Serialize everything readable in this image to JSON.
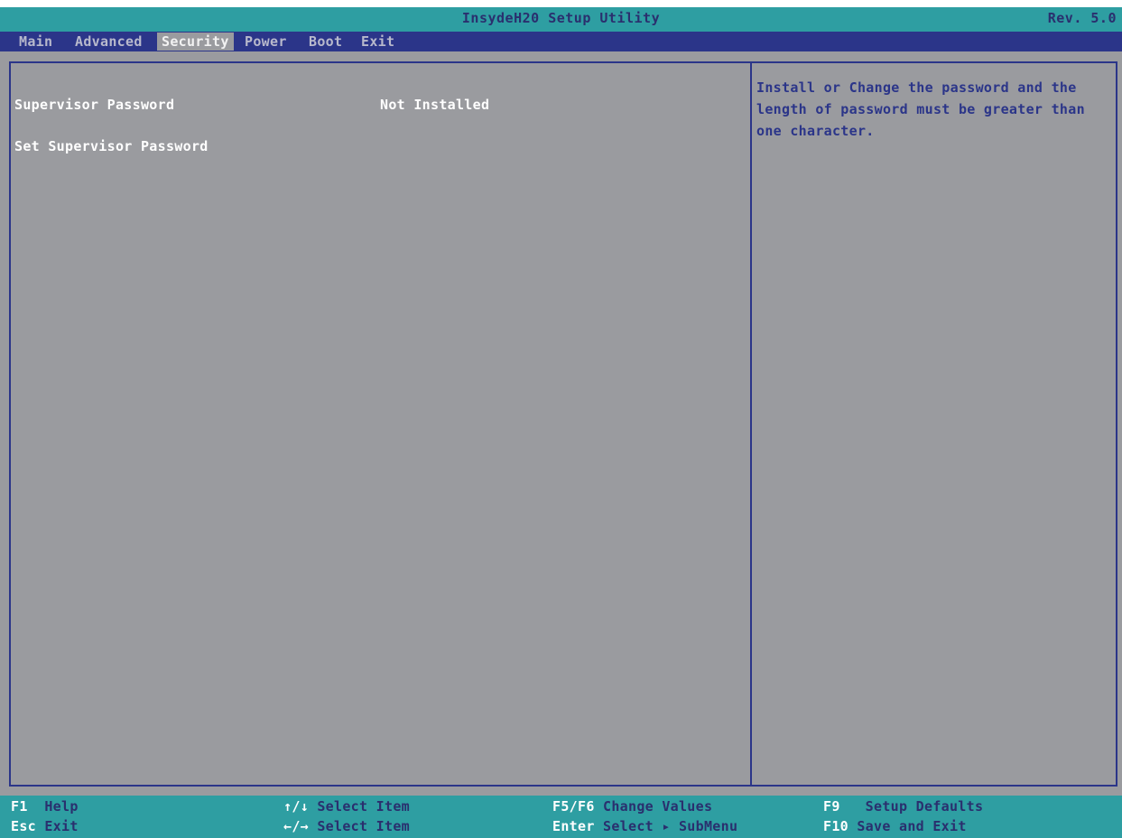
{
  "window": {
    "title": "InsydeH20 Setup Utility",
    "revision": "Rev. 5.0"
  },
  "menu": {
    "tabs": [
      {
        "label": "Main",
        "active": false
      },
      {
        "label": "Advanced",
        "active": false
      },
      {
        "label": "Security",
        "active": true
      },
      {
        "label": "Power",
        "active": false
      },
      {
        "label": "Boot",
        "active": false
      },
      {
        "label": "Exit",
        "active": false
      }
    ]
  },
  "settings": {
    "supervisor_password": {
      "label": "Supervisor Password",
      "value": "Not Installed"
    },
    "set_supervisor_password": {
      "label": "Set Supervisor Password"
    }
  },
  "help": {
    "lines": [
      "Install or Change the password and the",
      "length of password  must be greater than",
      "one character."
    ]
  },
  "footer": {
    "hints": [
      {
        "key": "F1",
        "desc": "Help"
      },
      {
        "key": "Esc",
        "desc": "Exit"
      },
      {
        "key": "↑/↓",
        "desc": "Select Item"
      },
      {
        "key": "←/→",
        "desc": "Select Item"
      },
      {
        "key": "F5/F6",
        "desc": "Change Values"
      },
      {
        "key": "Enter",
        "desc": "Select ▸ SubMenu"
      },
      {
        "key": "F9",
        "desc": "Setup Defaults"
      },
      {
        "key": "F10",
        "desc": "Save and Exit"
      }
    ]
  },
  "colors": {
    "background": "#9a9b9f",
    "title_bar": "#2e9ea2",
    "menu_bar": "#2b3589",
    "help_text": "#2b3589",
    "footer_bar": "#2e9ea2"
  }
}
